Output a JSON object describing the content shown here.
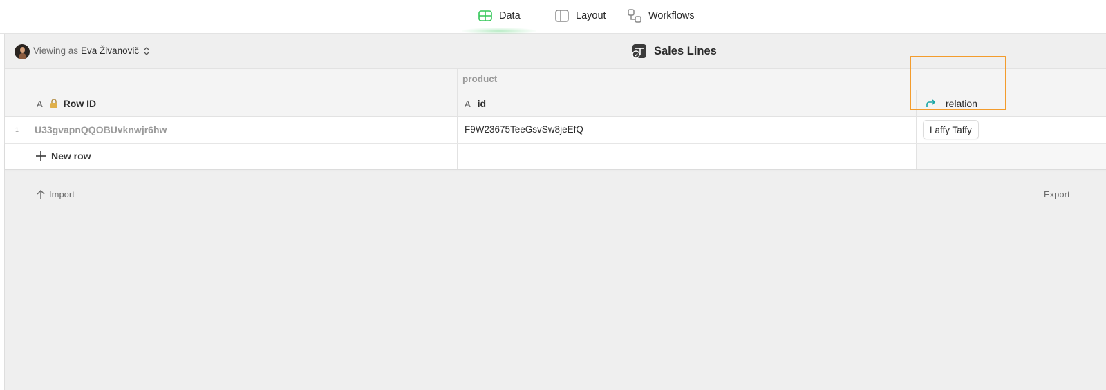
{
  "nav": {
    "tabs": [
      {
        "label": "Data",
        "icon": "table-icon",
        "active": true
      },
      {
        "label": "Layout",
        "icon": "layout-icon",
        "active": false
      },
      {
        "label": "Workflows",
        "icon": "workflows-icon",
        "active": false
      }
    ],
    "active_color": "#34c759"
  },
  "viewbar": {
    "viewing_prefix": "Viewing as",
    "user_name": "Eva Živanovič",
    "table_title": "Sales Lines"
  },
  "grid": {
    "group_label": "product",
    "columns": [
      {
        "label": "Row ID",
        "type_icon": "A",
        "locked": true
      },
      {
        "label": "id",
        "type_icon": "A"
      },
      {
        "label": "relation",
        "type_icon": "relation-arrow-icon"
      }
    ],
    "rows": [
      {
        "number": "1",
        "row_id": "U33gvapnQQOBUvknwjr6hw",
        "id": "F9W23675TeeGsvSw8jeEfQ",
        "relation": "Laffy Taffy"
      }
    ],
    "new_row_label": "New row",
    "highlight_color": "#f39c2d",
    "relation_icon_color": "#1aa6a6"
  },
  "footer": {
    "import_label": "Import",
    "export_label": "Export"
  }
}
